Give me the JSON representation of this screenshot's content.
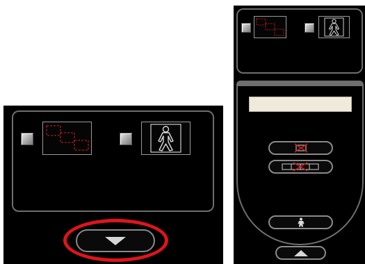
{
  "left_panel": {
    "option_select": {
      "checked": false,
      "icon": "select-grid-icon"
    },
    "option_person": {
      "checked": false,
      "icon": "person-icon"
    },
    "expand_button": {
      "icon": "triangle-down-icon"
    }
  },
  "right_panel": {
    "option_select": {
      "checked": false,
      "icon": "select-grid-icon"
    },
    "option_person": {
      "checked": false,
      "icon": "person-icon"
    },
    "text_field": {
      "value": ""
    },
    "buttons": [
      {
        "icon": "delete-single-icon"
      },
      {
        "icon": "delete-from-chain-icon"
      },
      {
        "icon": "person-small-icon"
      }
    ],
    "collapse_button": {
      "icon": "triangle-up-icon"
    }
  },
  "colors": {
    "highlight": "#e0141b",
    "field_bg": "#efeadb",
    "panel_bg": "#000000"
  }
}
